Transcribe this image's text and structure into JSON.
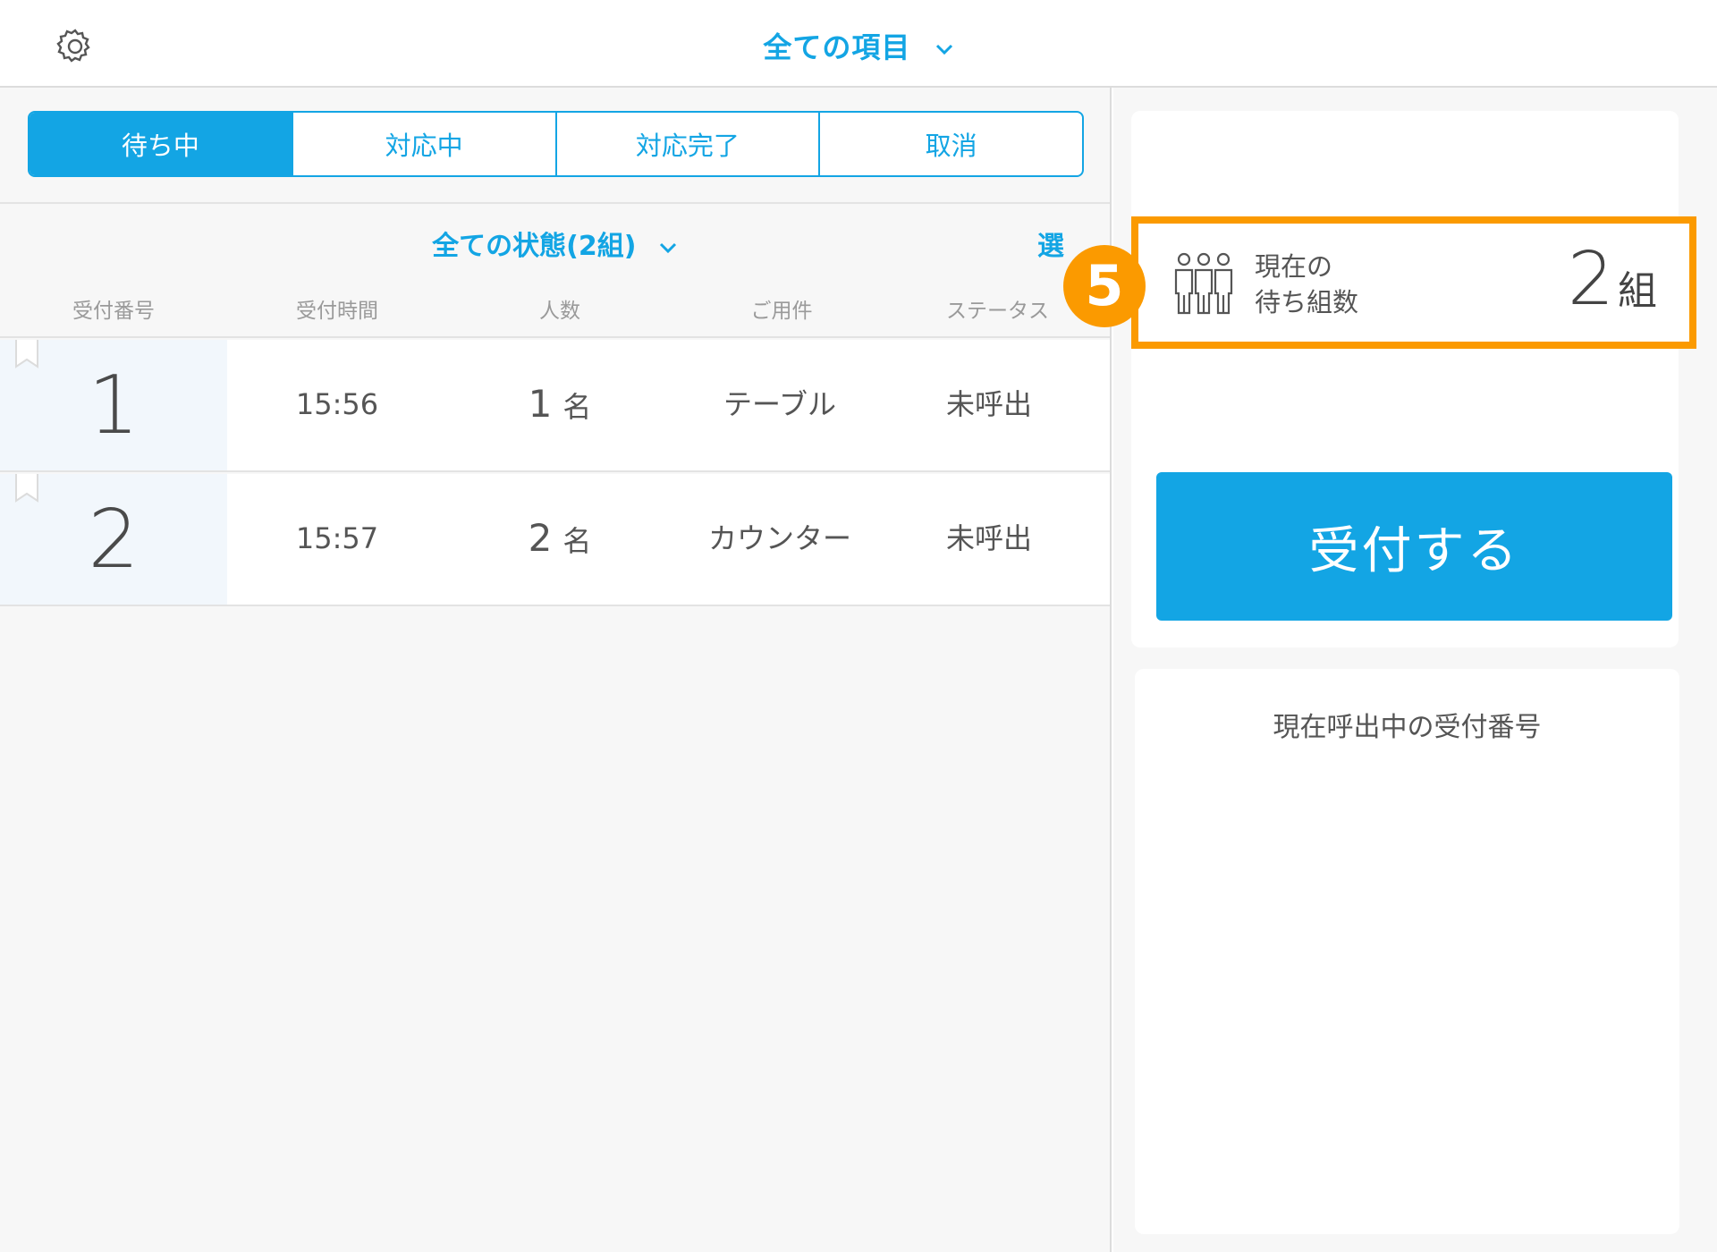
{
  "header": {
    "settings_icon": "gear-icon",
    "filter_title": "全ての項目",
    "filter_chevron": "chevron-down-icon"
  },
  "tabs": [
    {
      "label": "待ち中",
      "active": true
    },
    {
      "label": "対応中",
      "active": false
    },
    {
      "label": "対応完了",
      "active": false
    },
    {
      "label": "取消",
      "active": false
    }
  ],
  "list": {
    "status_filter": "全ての状態(2組)",
    "select_label": "選",
    "columns": [
      "受付番号",
      "受付時間",
      "人数",
      "ご用件",
      "ステータス"
    ],
    "rows": [
      {
        "number": "1",
        "time": "15:56",
        "people": "1",
        "people_unit": "名",
        "purpose": "テーブル",
        "status": "未呼出"
      },
      {
        "number": "2",
        "time": "15:57",
        "people": "2",
        "people_unit": "名",
        "purpose": "カウンター",
        "status": "未呼出"
      }
    ]
  },
  "summary": {
    "label_line1": "現在の",
    "label_line2": "待ち組数",
    "count": "2",
    "unit": "組",
    "badge": "5",
    "icon": "people-group-icon",
    "highlight_color": "#fb9a00"
  },
  "actions": {
    "accept_label": "受付する"
  },
  "calling": {
    "title": "現在呼出中の受付番号"
  },
  "colors": {
    "accent": "#13a5e4",
    "highlight": "#fb9a00"
  }
}
